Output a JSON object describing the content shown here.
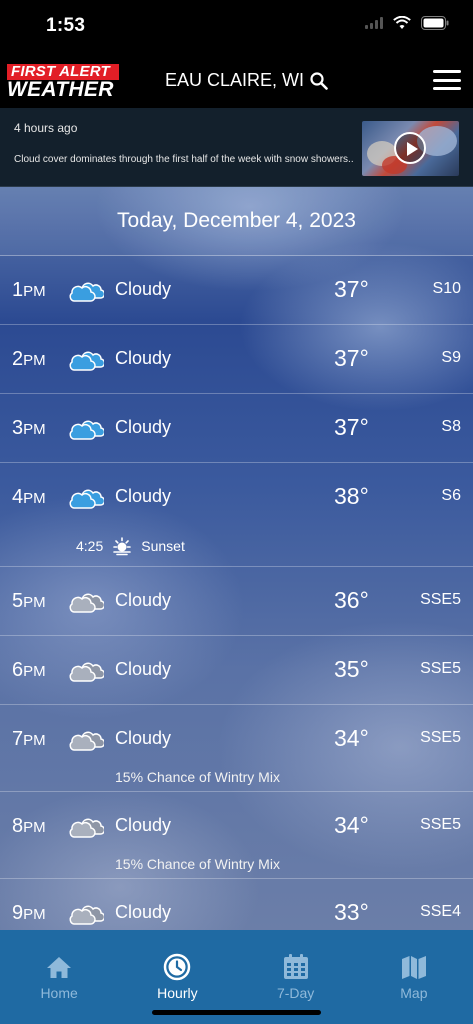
{
  "status_bar": {
    "time": "1:53"
  },
  "header": {
    "logo_line1": "FIRST ALERT",
    "logo_line2": "WEATHER",
    "location": "EAU CLAIRE, WI",
    "location_search_icon": "search-icon",
    "menu_icon": "hamburger-menu-icon"
  },
  "news": {
    "time_ago": "4 hours ago",
    "headline": "Cloud cover dominates through the first half of the week with snow showers...",
    "video_icon": "play-icon"
  },
  "date_header": "Today, December 4, 2023",
  "hours": [
    {
      "hour": "1",
      "period": "PM",
      "icon": "cloudy-icon",
      "condition": "Cloudy",
      "temp": "37°",
      "wind": "S10",
      "note": ""
    },
    {
      "hour": "2",
      "period": "PM",
      "icon": "cloudy-icon",
      "condition": "Cloudy",
      "temp": "37°",
      "wind": "S9",
      "note": ""
    },
    {
      "hour": "3",
      "period": "PM",
      "icon": "cloudy-icon",
      "condition": "Cloudy",
      "temp": "37°",
      "wind": "S8",
      "note": ""
    },
    {
      "hour": "4",
      "period": "PM",
      "icon": "cloudy-icon",
      "condition": "Cloudy",
      "temp": "38°",
      "wind": "S6",
      "note": ""
    },
    {
      "hour": "5",
      "period": "PM",
      "icon": "cloudy-night-icon",
      "condition": "Cloudy",
      "temp": "36°",
      "wind": "SSE5",
      "note": ""
    },
    {
      "hour": "6",
      "period": "PM",
      "icon": "cloudy-night-icon",
      "condition": "Cloudy",
      "temp": "35°",
      "wind": "SSE5",
      "note": ""
    },
    {
      "hour": "7",
      "period": "PM",
      "icon": "cloudy-night-icon",
      "condition": "Cloudy",
      "temp": "34°",
      "wind": "SSE5",
      "note": "15% Chance of Wintry Mix"
    },
    {
      "hour": "8",
      "period": "PM",
      "icon": "cloudy-night-icon",
      "condition": "Cloudy",
      "temp": "34°",
      "wind": "SSE5",
      "note": "15% Chance of Wintry Mix"
    },
    {
      "hour": "9",
      "period": "PM",
      "icon": "cloudy-night-icon",
      "condition": "Cloudy",
      "temp": "33°",
      "wind": "SSE4",
      "note": ""
    }
  ],
  "sunset": {
    "time": "4:25",
    "label": "Sunset",
    "icon": "sunset-icon"
  },
  "nav": [
    {
      "label": "Home",
      "icon": "home-icon",
      "active": false
    },
    {
      "label": "Hourly",
      "icon": "clock-icon",
      "active": true
    },
    {
      "label": "7-Day",
      "icon": "calendar-icon",
      "active": false
    },
    {
      "label": "Map",
      "icon": "map-icon",
      "active": false
    }
  ],
  "colors": {
    "nav_bg": "#1f6aa3",
    "nav_active": "#ffffff",
    "nav_inactive": "#8fb9da",
    "logo_red": "#e21e26",
    "day_cloud": "#3a9ee0"
  }
}
